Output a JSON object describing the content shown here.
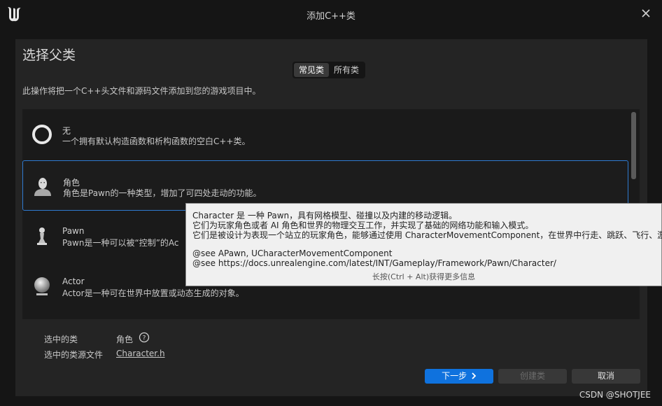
{
  "window": {
    "title": "添加C++类"
  },
  "heading": "选择父类",
  "tabs": [
    {
      "label": "常见类",
      "active": true
    },
    {
      "label": "所有类",
      "active": false
    }
  ],
  "description": "此操作将把一个C++头文件和源码文件添加到您的游戏项目中。",
  "classes": [
    {
      "name": "无",
      "desc": "一个拥有默认构造函数和析构函数的空白C++类。",
      "icon": "ring-icon"
    },
    {
      "name": "角色",
      "desc": "角色是Pawn的一种类型，增加了可四处走动的功能。",
      "icon": "character-icon",
      "selected": true
    },
    {
      "name": "Pawn",
      "desc": "Pawn是一种可以被“控制”的Ac",
      "icon": "pawn-icon"
    },
    {
      "name": "Actor",
      "desc": "Actor是一种可在世界中放置或动态生成的对象。",
      "icon": "sphere-icon"
    }
  ],
  "selected_class": {
    "label": "选中的类",
    "value": "角色"
  },
  "selected_source": {
    "label": "选中的类源文件",
    "value": "Character.h"
  },
  "buttons": {
    "next": "下一步",
    "create": "创建类",
    "cancel": "取消"
  },
  "tooltip": {
    "line1": "Character 是 一种 Pawn，具有网格模型、碰撞以及内建的移动逻辑。",
    "line2": "它们为玩家角色或者 AI 角色和世界的物理交互工作，并实现了基础的网络功能和输入模式。",
    "line3": "它们是被设计为表现一个站立的玩家角色，能够通过使用 CharacterMovementComponent，在世界中行走、跳跃、飞行、游泳。",
    "line4": "@see APawn, UCharacterMovementComponent",
    "line5": "@see https://docs.unrealengine.com/latest/INT/Gameplay/Framework/Pawn/Character/",
    "hint": "长按(Ctrl + Alt)获得更多信息"
  },
  "watermark": "CSDN @SHOTJEE",
  "colors": {
    "accent": "#0f72de",
    "selection_border": "#2f7ad0",
    "panel": "#242424",
    "background": "#151515"
  }
}
